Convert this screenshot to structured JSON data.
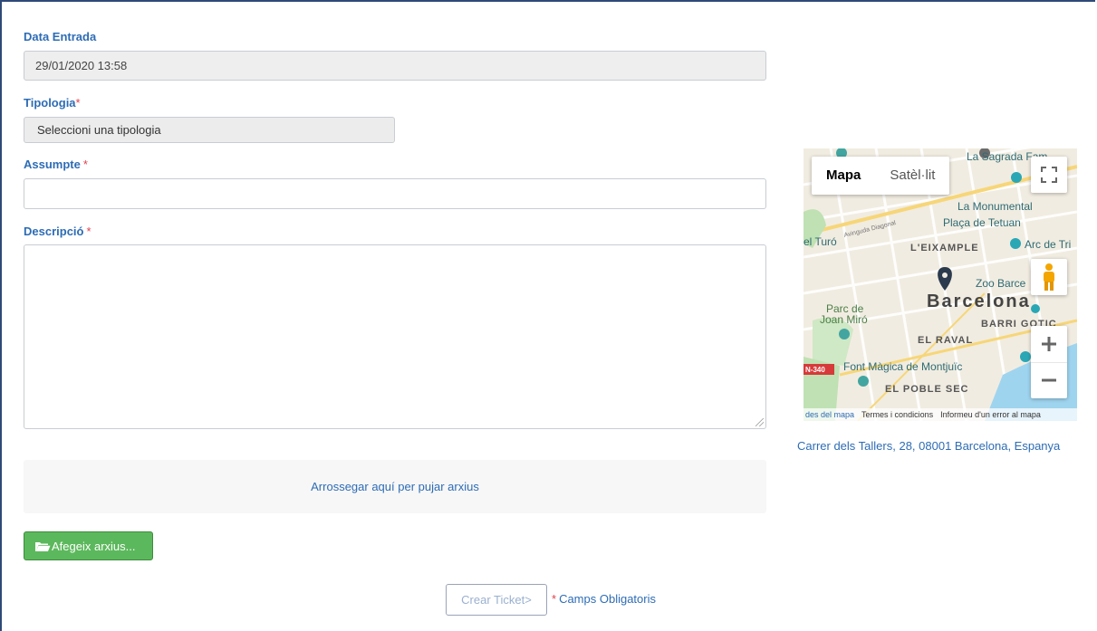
{
  "form": {
    "entry_date_label": "Data Entrada",
    "entry_date_value": "29/01/2020 13:58",
    "typology_label": "Tipologia",
    "typology_required": "*",
    "typology_select": "Seleccioni una tipologia",
    "subject_label": "Assumpte",
    "subject_required": "*",
    "subject_value": "",
    "description_label": "Descripció",
    "description_required": "*",
    "description_value": "",
    "dropzone_text": "Arrossegar aquí per pujar arxius",
    "add_files_button": "Afegeix arxius...",
    "create_ticket_button": "Crear Ticket>",
    "mandatory_star": "*",
    "mandatory_note": "Camps Obligatoris"
  },
  "map": {
    "type_map": "Mapa",
    "type_satellite": "Satèl·lit",
    "labels": {
      "sagrada": "La Sagrada Fam",
      "monumental": "La Monumental",
      "tetuan": "Plaça de Tetuan",
      "turo": "el Turó",
      "diagonal": "Avinguda Diagonal",
      "eixample": "L'EIXAMPLE",
      "arc": "Arc de Tri",
      "zoo": "Zoo Barce",
      "city": "Barcelona",
      "parc": "Parc de",
      "parc2": "Joan Miró",
      "gotic": "BARRI GOTIC",
      "raval": "EL RAVAL",
      "n340": "N-340",
      "font": "Font Màgica de Montjuïc",
      "poble_sec": "EL POBLE SEC"
    },
    "footer_data": "des del mapa",
    "footer_terms": "Termes i condicions",
    "footer_report": "Informeu d'un error al mapa",
    "address": "Carrer dels Tallers, 28, 08001 Barcelona, Espanya"
  },
  "colors": {
    "label_blue": "#2d6cb5",
    "required_red": "#e0424f",
    "button_green": "#5cb85c"
  }
}
